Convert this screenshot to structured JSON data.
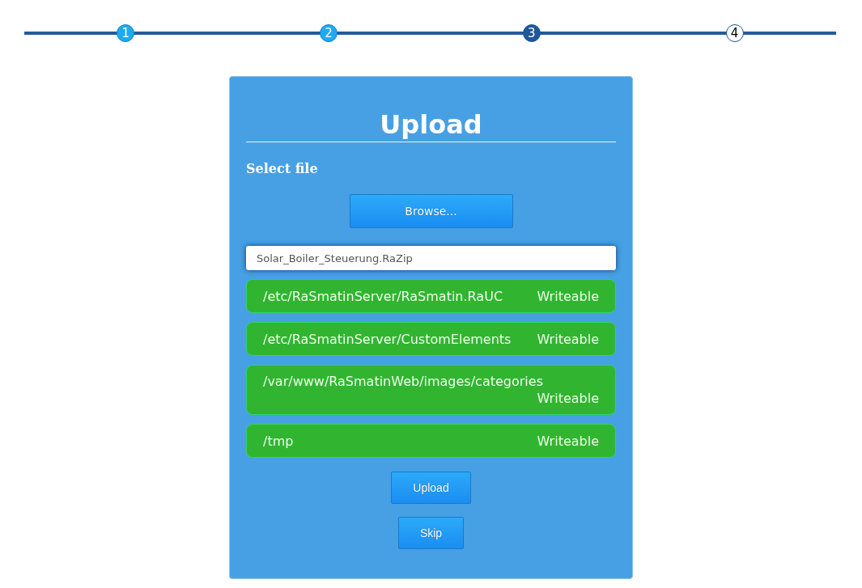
{
  "steps": [
    {
      "label": "1",
      "completed": true,
      "selected": false
    },
    {
      "label": "2",
      "completed": true,
      "selected": false
    },
    {
      "label": "3",
      "completed": false,
      "selected": true
    },
    {
      "label": "4",
      "completed": false,
      "selected": false
    }
  ],
  "panel": {
    "title": "Upload",
    "section_label": "Select file",
    "browse_button": "Browse...",
    "file_field": {
      "value": "Solar_Boiler_Steuerung.RaZip"
    },
    "paths": [
      {
        "path": "/etc/RaSmatinServer/RaSmatin.RaUC",
        "status": "Writeable"
      },
      {
        "path": "/etc/RaSmatinServer/CustomElements",
        "status": "Writeable"
      },
      {
        "path": "/var/www/RaSmatinWeb/images/categories",
        "status": "Writeable"
      },
      {
        "path": "/tmp",
        "status": "Writeable"
      }
    ],
    "buttons": [
      "Upload",
      "Skip"
    ]
  }
}
